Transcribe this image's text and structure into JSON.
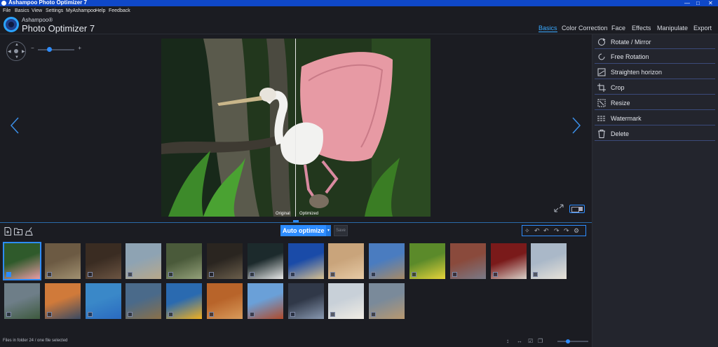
{
  "window": {
    "title": "Ashampoo Photo Optimizer 7",
    "controls": [
      "—",
      "□",
      "✕"
    ]
  },
  "menu": [
    "File",
    "Basics",
    "View",
    "Settings",
    "MyAshampoo",
    "Help",
    "Feedback"
  ],
  "brand": {
    "line1": "Ashampoo®",
    "line2": "Photo Optimizer 7"
  },
  "tabs": [
    {
      "label": "Basics",
      "active": true
    },
    {
      "label": "Color Correction",
      "active": false
    },
    {
      "label": "Face",
      "active": false
    },
    {
      "label": "Effects",
      "active": false
    },
    {
      "label": "Manipulate",
      "active": false
    },
    {
      "label": "Export",
      "active": false
    }
  ],
  "zoom": {
    "minus": "−",
    "plus": "+",
    "level": 0.25
  },
  "viewer": {
    "label_left": "Original",
    "label_right": "Optimized"
  },
  "side_panel": [
    {
      "label": "Rotate / Mirror",
      "icon": "rotate-icon"
    },
    {
      "label": "Free Rotation",
      "icon": "free-rotation-icon"
    },
    {
      "label": "Straighten horizon",
      "icon": "straighten-horizon-icon"
    },
    {
      "label": "Crop",
      "icon": "crop-icon"
    },
    {
      "label": "Resize",
      "icon": "resize-icon"
    },
    {
      "label": "Watermark",
      "icon": "watermark-icon"
    },
    {
      "label": "Delete",
      "icon": "trash-icon"
    }
  ],
  "toolbar": {
    "auto_optimize": "Auto optimize",
    "save": "Save"
  },
  "thumbnails": [
    {
      "subject": "spoonbill",
      "colors": [
        "#2f5a2b",
        "#e89ba4"
      ],
      "selected": true
    },
    {
      "subject": "monkey",
      "colors": [
        "#6c5a43",
        "#a09070"
      ]
    },
    {
      "subject": "roof-tiles",
      "colors": [
        "#3a2c22",
        "#6b5442"
      ]
    },
    {
      "subject": "coast",
      "colors": [
        "#8ea3b3",
        "#b8a88a"
      ]
    },
    {
      "subject": "seaside-grass",
      "colors": [
        "#4a5a3a",
        "#93a079"
      ]
    },
    {
      "subject": "cafe-street",
      "colors": [
        "#2a2520",
        "#6a5e4b"
      ]
    },
    {
      "subject": "egret",
      "colors": [
        "#1c2a2c",
        "#e8e8e8"
      ]
    },
    {
      "subject": "person-hat",
      "colors": [
        "#1a4ba8",
        "#d7c090"
      ]
    },
    {
      "subject": "desert",
      "colors": [
        "#c9a47b",
        "#e6caa5"
      ]
    },
    {
      "subject": "eiffel-tower",
      "colors": [
        "#4a7cc0",
        "#a78a66"
      ]
    },
    {
      "subject": "flowers",
      "colors": [
        "#5b8a2a",
        "#e6d33a"
      ]
    },
    {
      "subject": "canal-buildings",
      "colors": [
        "#8a4a3c",
        "#7a7a88"
      ]
    },
    {
      "subject": "man-portrait",
      "colors": [
        "#7a1a1a",
        "#d8d0c8"
      ]
    },
    {
      "subject": "lighthouse",
      "colors": [
        "#aab8c8",
        "#e8e2d8"
      ]
    },
    {
      "subject": "lake-mountain",
      "colors": [
        "#6e7e88",
        "#3e5a3e"
      ]
    },
    {
      "subject": "sunset-road",
      "colors": [
        "#d07a3a",
        "#3a4a62"
      ]
    },
    {
      "subject": "classic-car",
      "colors": [
        "#3a88c8",
        "#2a6ac0"
      ]
    },
    {
      "subject": "old-truck",
      "colors": [
        "#4a6a8a",
        "#8a7048"
      ]
    },
    {
      "subject": "parrot",
      "colors": [
        "#2a6ab0",
        "#f0b020"
      ]
    },
    {
      "subject": "cat",
      "colors": [
        "#b8642a",
        "#d89a5a"
      ]
    },
    {
      "subject": "golden-gate",
      "colors": [
        "#6aa0d8",
        "#b04a2a"
      ]
    },
    {
      "subject": "city-street",
      "colors": [
        "#303848",
        "#8898b0"
      ]
    },
    {
      "subject": "taj-mahal",
      "colors": [
        "#c8d0d8",
        "#f0ece4"
      ]
    },
    {
      "subject": "landscape-hills",
      "colors": [
        "#7a8a9a",
        "#b89870"
      ]
    }
  ],
  "status": {
    "text": "Files in folder 24 / one file selected"
  }
}
